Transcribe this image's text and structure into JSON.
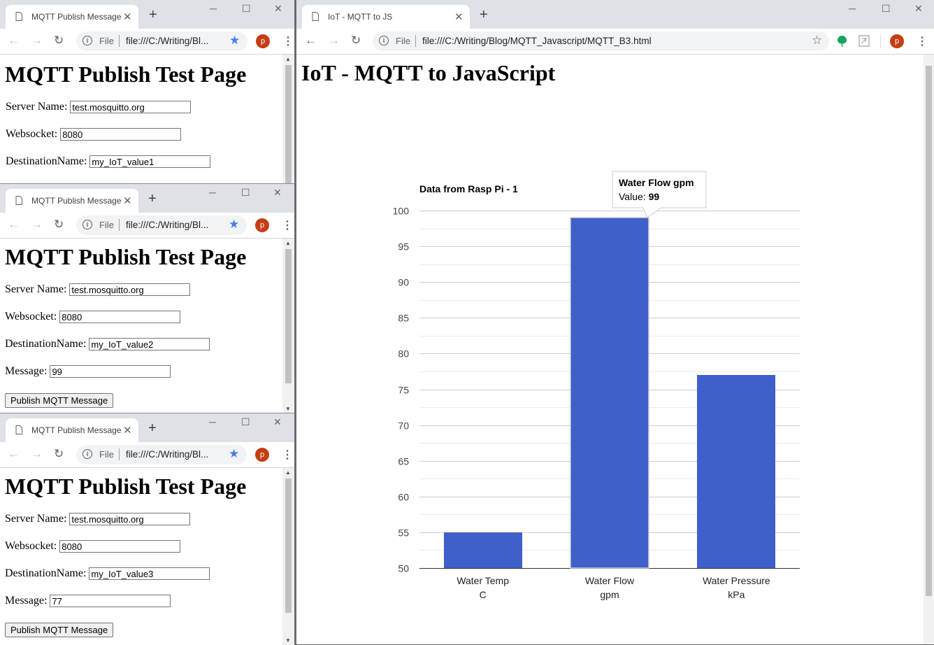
{
  "publisher_windows": [
    {
      "tab_title": "MQTT Publish Message",
      "url_scheme": "File",
      "url": "file:///C:/Writing/Bl...",
      "avatar": "p",
      "heading": "MQTT Publish Test Page",
      "server_label": "Server Name:",
      "server_value": "test.mosquitto.org",
      "websocket_label": "Websocket:",
      "websocket_value": "8080",
      "destination_label": "DestinationName:",
      "destination_value": "my_IoT_value1"
    },
    {
      "tab_title": "MQTT Publish Message",
      "url_scheme": "File",
      "url": "file:///C:/Writing/Bl...",
      "avatar": "p",
      "heading": "MQTT Publish Test Page",
      "server_label": "Server Name:",
      "server_value": "test.mosquitto.org",
      "websocket_label": "Websocket:",
      "websocket_value": "8080",
      "destination_label": "DestinationName:",
      "destination_value": "my_IoT_value2",
      "message_label": "Message:",
      "message_value": "99",
      "button_label": "Publish MQTT Message"
    },
    {
      "tab_title": "MQTT Publish Message",
      "url_scheme": "File",
      "url": "file:///C:/Writing/Bl...",
      "avatar": "p",
      "heading": "MQTT Publish Test Page",
      "server_label": "Server Name:",
      "server_value": "test.mosquitto.org",
      "websocket_label": "Websocket:",
      "websocket_value": "8080",
      "destination_label": "DestinationName:",
      "destination_value": "my_IoT_value3",
      "message_label": "Message:",
      "message_value": "77",
      "button_label": "Publish MQTT Message"
    }
  ],
  "main_window": {
    "tab_title": "IoT - MQTT to JS",
    "url_scheme": "File",
    "url": "file:///C:/Writing/Blog/MQTT_Javascript/MQTT_B3.html",
    "avatar": "p",
    "heading": "IoT - MQTT to JavaScript"
  },
  "chart_data": {
    "type": "bar",
    "title": "Data from Rasp Pi - 1",
    "categories": [
      [
        "Water Temp",
        "C"
      ],
      [
        "Water Flow",
        "gpm"
      ],
      [
        "Water Pressure",
        "kPa"
      ]
    ],
    "values": [
      55,
      99,
      77
    ],
    "ylim": [
      50,
      100
    ],
    "yticks": [
      "50",
      "55",
      "60",
      "65",
      "70",
      "75",
      "80",
      "85",
      "90",
      "95",
      "100"
    ],
    "bar_color": "#3f5fc9",
    "highlighted_index": 1,
    "tooltip": {
      "title": "Water Flow gpm",
      "value_label": "Value:",
      "value": "99"
    }
  }
}
